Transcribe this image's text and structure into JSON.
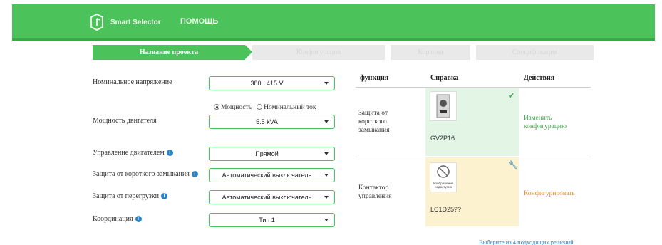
{
  "header": {
    "brand": "Smart Selector",
    "help": "ПОМОЩЬ",
    "colors": {
      "green": "#4cc25a",
      "text": "#eaffea"
    },
    "logo_icon": "smart-selector-logo-icon"
  },
  "steps": [
    {
      "label": "Название проекта",
      "active": true
    },
    {
      "label": "Конфигурация",
      "active": false
    },
    {
      "label": "Корзина",
      "active": false
    },
    {
      "label": "Спецификация",
      "active": false
    }
  ],
  "form": {
    "voltage": {
      "label": "Номинальное напряжение",
      "value": "380...415 V"
    },
    "power_mode": {
      "option_power": "Мощность",
      "option_current": "Номинальный ток",
      "selected": "power"
    },
    "motor_power": {
      "label": "Мощность двигателя",
      "value": "5.5 kVA"
    },
    "motor_control": {
      "label": "Управление двигателем",
      "value": "Прямой"
    },
    "short_circuit": {
      "label": "Защита от короткого замыкания",
      "value": "Автоматический выключатель"
    },
    "overload": {
      "label": "Защита от перегрузки",
      "value": "Автоматический выключатель"
    },
    "coordination": {
      "label": "Координация",
      "value": "Тип 1"
    }
  },
  "table": {
    "headers": {
      "function": "функция",
      "reference": "Справка",
      "actions": "Действия"
    },
    "rows": [
      {
        "function": "Защита от короткого замыкания",
        "reference": "GV2P16",
        "action": "Изменить конфигурацию",
        "status_icon": "check-icon"
      },
      {
        "function": "Контактор управления",
        "reference": "LC1D25??",
        "image_caption": "Изображение недоступно",
        "action": "Конфигурировать",
        "status_icon": "wrench-icon"
      }
    ]
  },
  "footer": {
    "link": "Выберите из 4 подходящих решений"
  }
}
